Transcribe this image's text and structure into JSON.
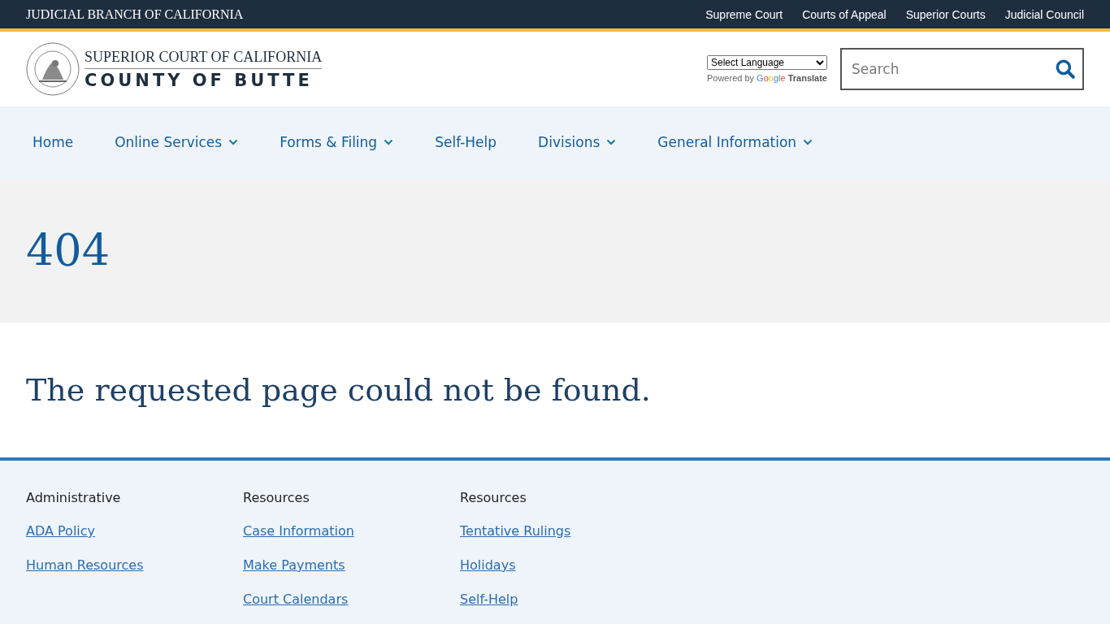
{
  "top_bar": {
    "title": "JUDICIAL BRANCH OF CALIFORNIA",
    "links": [
      "Supreme Court",
      "Courts of Appeal",
      "Superior Courts",
      "Judicial Council"
    ]
  },
  "header": {
    "logo_line_1": "SUPERIOR COURT OF CALIFORNIA",
    "logo_line_2": "COUNTY OF BUTTE",
    "language_select": "Select Language",
    "powered_by": "Powered by",
    "translate_brand": "Google",
    "translate_word": "Translate",
    "search": {
      "placeholder": "Search"
    }
  },
  "nav": [
    {
      "label": "Home",
      "has_menu": false
    },
    {
      "label": "Online Services",
      "has_menu": true
    },
    {
      "label": "Forms & Filing",
      "has_menu": true
    },
    {
      "label": "Self-Help",
      "has_menu": false
    },
    {
      "label": "Divisions",
      "has_menu": true
    },
    {
      "label": "General Information",
      "has_menu": true
    }
  ],
  "hero": {
    "title": "404"
  },
  "message": "The requested page could not be found.",
  "footer": {
    "columns": [
      {
        "heading": "Administrative",
        "links": [
          "ADA Policy",
          "Human Resources"
        ]
      },
      {
        "heading": "Resources",
        "links": [
          "Case Information",
          "Make Payments",
          "Court Calendars"
        ]
      },
      {
        "heading": "Resources",
        "links": [
          "Tentative Rulings",
          "Holidays",
          "Self-Help"
        ]
      }
    ]
  }
}
